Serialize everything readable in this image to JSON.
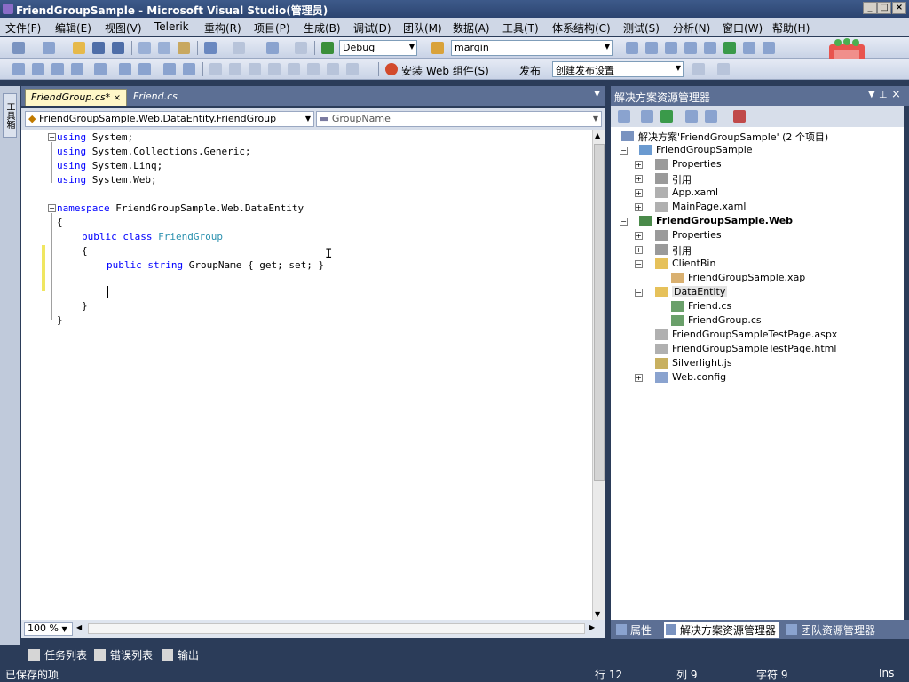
{
  "window": {
    "title": "FriendGroupSample - Microsoft Visual Studio(管理员)"
  },
  "menu": [
    "文件(F)",
    "编辑(E)",
    "视图(V)",
    "Telerik",
    "重构(R)",
    "项目(P)",
    "生成(B)",
    "调试(D)",
    "团队(M)",
    "数据(A)",
    "工具(T)",
    "体系结构(C)",
    "测试(S)",
    "分析(N)",
    "窗口(W)",
    "帮助(H)"
  ],
  "toolbar": {
    "config": "Debug",
    "find": "margin",
    "install_web": "安装 Web 组件(S)",
    "publish": "发布",
    "publish_setting": "创建发布设置"
  },
  "left_strip": {
    "toolbox": "工具箱"
  },
  "doc_tabs": [
    "FriendGroup.cs*",
    "Friend.cs"
  ],
  "nav": {
    "type": "FriendGroupSample.Web.DataEntity.FriendGroup",
    "member": "GroupName"
  },
  "code": {
    "l1": "System;",
    "l2": "System.Collections.Generic;",
    "l3": "System.Linq;",
    "l4": "System.Web;",
    "ns": "FriendGroupSample.Web.DataEntity",
    "cls": "FriendGroup",
    "prop_type": "string",
    "prop": "GroupName { get; set; }",
    "kw_using": "using",
    "kw_namespace": "namespace",
    "kw_public": "public",
    "kw_class": "class",
    "open": "{",
    "close": "}"
  },
  "zoom": "100 %",
  "solution_explorer": {
    "title": "解决方案资源管理器",
    "items": [
      "解决方案'FriendGroupSample' (2 个项目)",
      "FriendGroupSample",
      "Properties",
      "引用",
      "App.xaml",
      "MainPage.xaml",
      "FriendGroupSample.Web",
      "Properties",
      "引用",
      "ClientBin",
      "FriendGroupSample.xap",
      "DataEntity",
      "Friend.cs",
      "FriendGroup.cs",
      "FriendGroupSampleTestPage.aspx",
      "FriendGroupSampleTestPage.html",
      "Silverlight.js",
      "Web.config"
    ]
  },
  "bottom_tabs": [
    "属性",
    "解决方案资源管理器",
    "团队资源管理器"
  ],
  "tool_windows": [
    "任务列表",
    "错误列表",
    "输出"
  ],
  "status": {
    "message": "已保存的项",
    "line": "行 12",
    "col": "列 9",
    "ch": "字符 9",
    "mode": "Ins"
  }
}
